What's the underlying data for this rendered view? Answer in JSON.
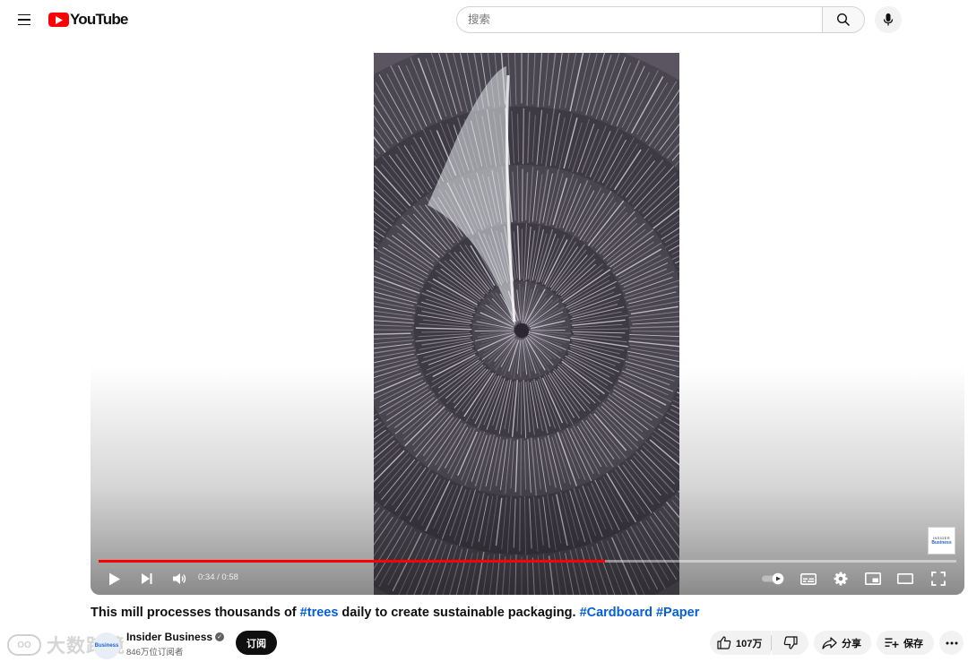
{
  "masthead": {
    "logo_text": "YouTube",
    "search_placeholder": "搜索",
    "icons": {
      "menu": "hamburger-menu-icon",
      "search": "search-icon",
      "mic": "microphone-icon"
    },
    "brand_color": "#ff0000"
  },
  "player": {
    "time_current": "0:34",
    "time_separator": " / ",
    "time_total": "0:58",
    "progress_fraction": 0.59,
    "watermark_line1": "INSIDER",
    "watermark_line2": "Business",
    "controls": [
      "play-icon",
      "next-icon",
      "volume-icon",
      "autoplay-toggle-icon",
      "subtitles-icon",
      "settings-icon",
      "miniplayer-icon",
      "theater-icon",
      "fullscreen-icon"
    ]
  },
  "video": {
    "title_text": "This mill processes thousands of ",
    "tag_trees": "#trees",
    "title_mid": " daily to create sustainable packaging. ",
    "tag_cardboard": "#Cardboard",
    "tag_paper": "#Paper"
  },
  "owner": {
    "channel_name": "Insider Business",
    "subscribers": "846万位订阅者",
    "subscribe_label": "订阅",
    "avatar_text": "Business"
  },
  "actions": {
    "like_count": "107万",
    "share_label": "分享",
    "save_label": "保存"
  },
  "overlay_brand": {
    "logo_text": "OO",
    "text": "大数跨境"
  }
}
